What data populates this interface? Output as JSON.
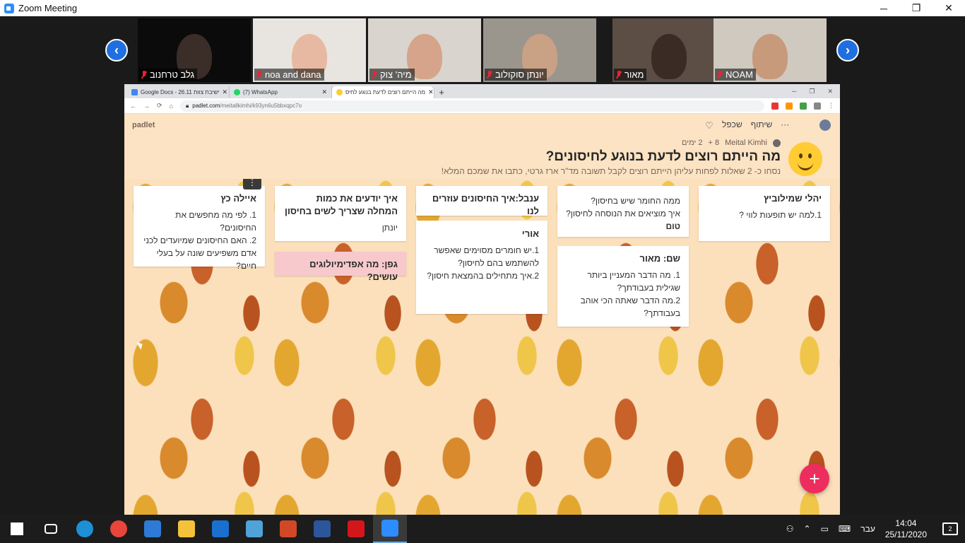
{
  "window": {
    "title": "Zoom Meeting",
    "minimize": "─",
    "restore": "❐",
    "close": "✕"
  },
  "gallery": {
    "prev": "‹",
    "next": "›",
    "tiles": [
      {
        "name": "גלב טרחנוב",
        "bg": "#0b0b0b",
        "face": "#3b2d28"
      },
      {
        "name": "noa and dana",
        "bg": "#e8e5e0",
        "face": "#e8b9a2"
      },
      {
        "name": "מיה' צוק",
        "bg": "#d9d4cd",
        "face": "#d6a48a"
      },
      {
        "name": "יונתן סוקולוב",
        "bg": "#9b968d",
        "face": "#c9a184"
      },
      {
        "name": "מאור",
        "bg": "#5c4e45",
        "face": "#3a2c25"
      },
      {
        "name": "NOAM",
        "bg": "#cfc9c0",
        "face": "#c79a7c"
      }
    ]
  },
  "browser": {
    "tabs": [
      {
        "label": "Google Docs - 26.11 ישיבת צוות",
        "color": "#4285f4"
      },
      {
        "label": "(7) WhatsApp",
        "color": "#25d366"
      },
      {
        "label": "מה הייתם רוצים לדעת בנוגע לחיס",
        "color": "#ffcc33"
      }
    ],
    "newtab": "+",
    "url_host": "padlet.com",
    "url_path": "/meitallkimhi/k93yn6u5bbxqpc7o",
    "nav": {
      "back": "←",
      "forward": "→",
      "reload": "⟳",
      "home": "⌂"
    }
  },
  "padlet": {
    "logo": "padlet",
    "actions": {
      "share": "שיתוף",
      "remake": "שכפל",
      "more": "···",
      "heart": "♡"
    },
    "meta": {
      "author": "Meital Kimhi",
      "likes": "8 +",
      "age": "2 ימים"
    },
    "title": "מה הייתם רוצים לדעת בנוגע לחיסונים?",
    "subtitle": "נסחו כ- 2 שאלות לפחות עליהן הייתם רוצים לקבל תשובה מד\"ר ארז גרטי, כתבו את שמכם המלא!",
    "kebab": "⋮",
    "fab": "+"
  },
  "posts": [
    {
      "title": "יהלי שמילוביץ",
      "lines": [
        "1.למה יש תופעות לווי ?"
      ]
    },
    {
      "title": "",
      "lines": [
        "ממה החומר שיש בחיסון?",
        "איך מוציאים את הנוסחה לחיסון?"
      ],
      "bold": "טום"
    },
    {
      "title": "שם: מאור",
      "lines": [
        "1. מה הדבר המעניין ביותר שגילית בעבודתך?",
        "2.מה הדבר שאתה הכי אוהב בעבודתך?"
      ]
    },
    {
      "title": "ענבל:איך החיסונים עוזרים לנו",
      "lines": []
    },
    {
      "title": "אורי",
      "lines": [
        "1.יש חומרים מסוימים שאפשר להשתמש בהם לחיסון?",
        "2.איך מתחילים בהמצאת חיסון?"
      ]
    },
    {
      "title": "איך יודעים את כמות המחלה שצריך לשים בחיסון",
      "lines": [
        "יונתן"
      ]
    },
    {
      "title": "גפן: מה אפדימיולוגים עושים?",
      "lines": []
    },
    {
      "title": "איילה כץ",
      "lines": [
        "1. לפי מה מחפשים את החיסונים?",
        "2. האם החיסונים שמיועדים לכני אדם משפיעים שונה על בעלי חיים?"
      ]
    }
  ],
  "taskbar": {
    "apps": [
      {
        "name": "start",
        "color": "#ffffff"
      },
      {
        "name": "task-view",
        "color": "#ffffff"
      },
      {
        "name": "edge",
        "color": "#1e8fd6"
      },
      {
        "name": "chrome",
        "color": "#e8453c"
      },
      {
        "name": "store",
        "color": "#2d7bd6"
      },
      {
        "name": "explorer",
        "color": "#f3c23a"
      },
      {
        "name": "mail",
        "color": "#1b6fce"
      },
      {
        "name": "paint",
        "color": "#4fa3d8"
      },
      {
        "name": "powerpoint",
        "color": "#d24726"
      },
      {
        "name": "word",
        "color": "#2b579a"
      },
      {
        "name": "acrobat",
        "color": "#d4161c"
      },
      {
        "name": "zoom",
        "color": "#2d8cff"
      }
    ],
    "lang": "עבר",
    "time": "14:04",
    "date": "25/11/2020",
    "notifications": "2"
  }
}
